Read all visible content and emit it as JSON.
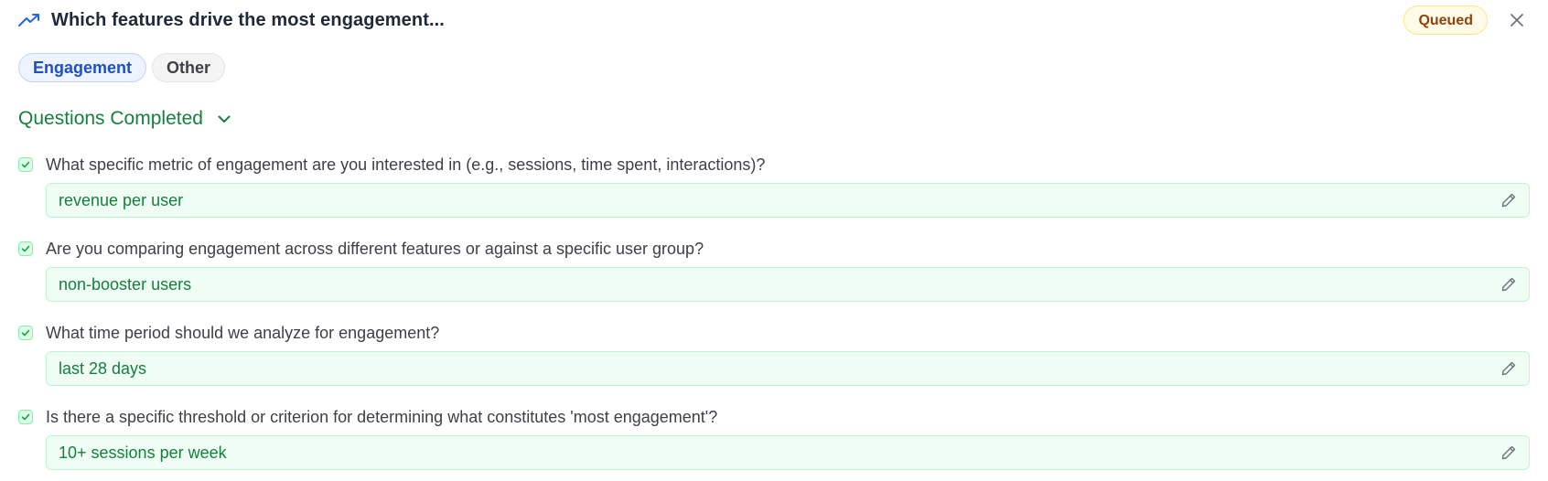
{
  "header": {
    "title": "Which features drive the most engagement...",
    "status": "Queued",
    "trend_icon": "trending-up-icon",
    "close_icon": "close-icon"
  },
  "tags": [
    {
      "label": "Engagement",
      "selected": true
    },
    {
      "label": "Other",
      "selected": false
    }
  ],
  "section": {
    "title": "Questions Completed",
    "expanded": true
  },
  "questions": [
    {
      "question": "What specific metric of engagement are you interested in (e.g., sessions, time spent, interactions)?",
      "answer": "revenue per user"
    },
    {
      "question": "Are you comparing engagement across different features or against a specific user group?",
      "answer": "non-booster users"
    },
    {
      "question": "What time period should we analyze for engagement?",
      "answer": "last 28 days"
    },
    {
      "question": "Is there a specific threshold or criterion for determining what constitutes 'most engagement'?",
      "answer": "10+ sessions per week"
    }
  ],
  "colors": {
    "accent_green": "#15803d",
    "accent_blue": "#1e4fc4",
    "badge_amber": "#92400e"
  }
}
